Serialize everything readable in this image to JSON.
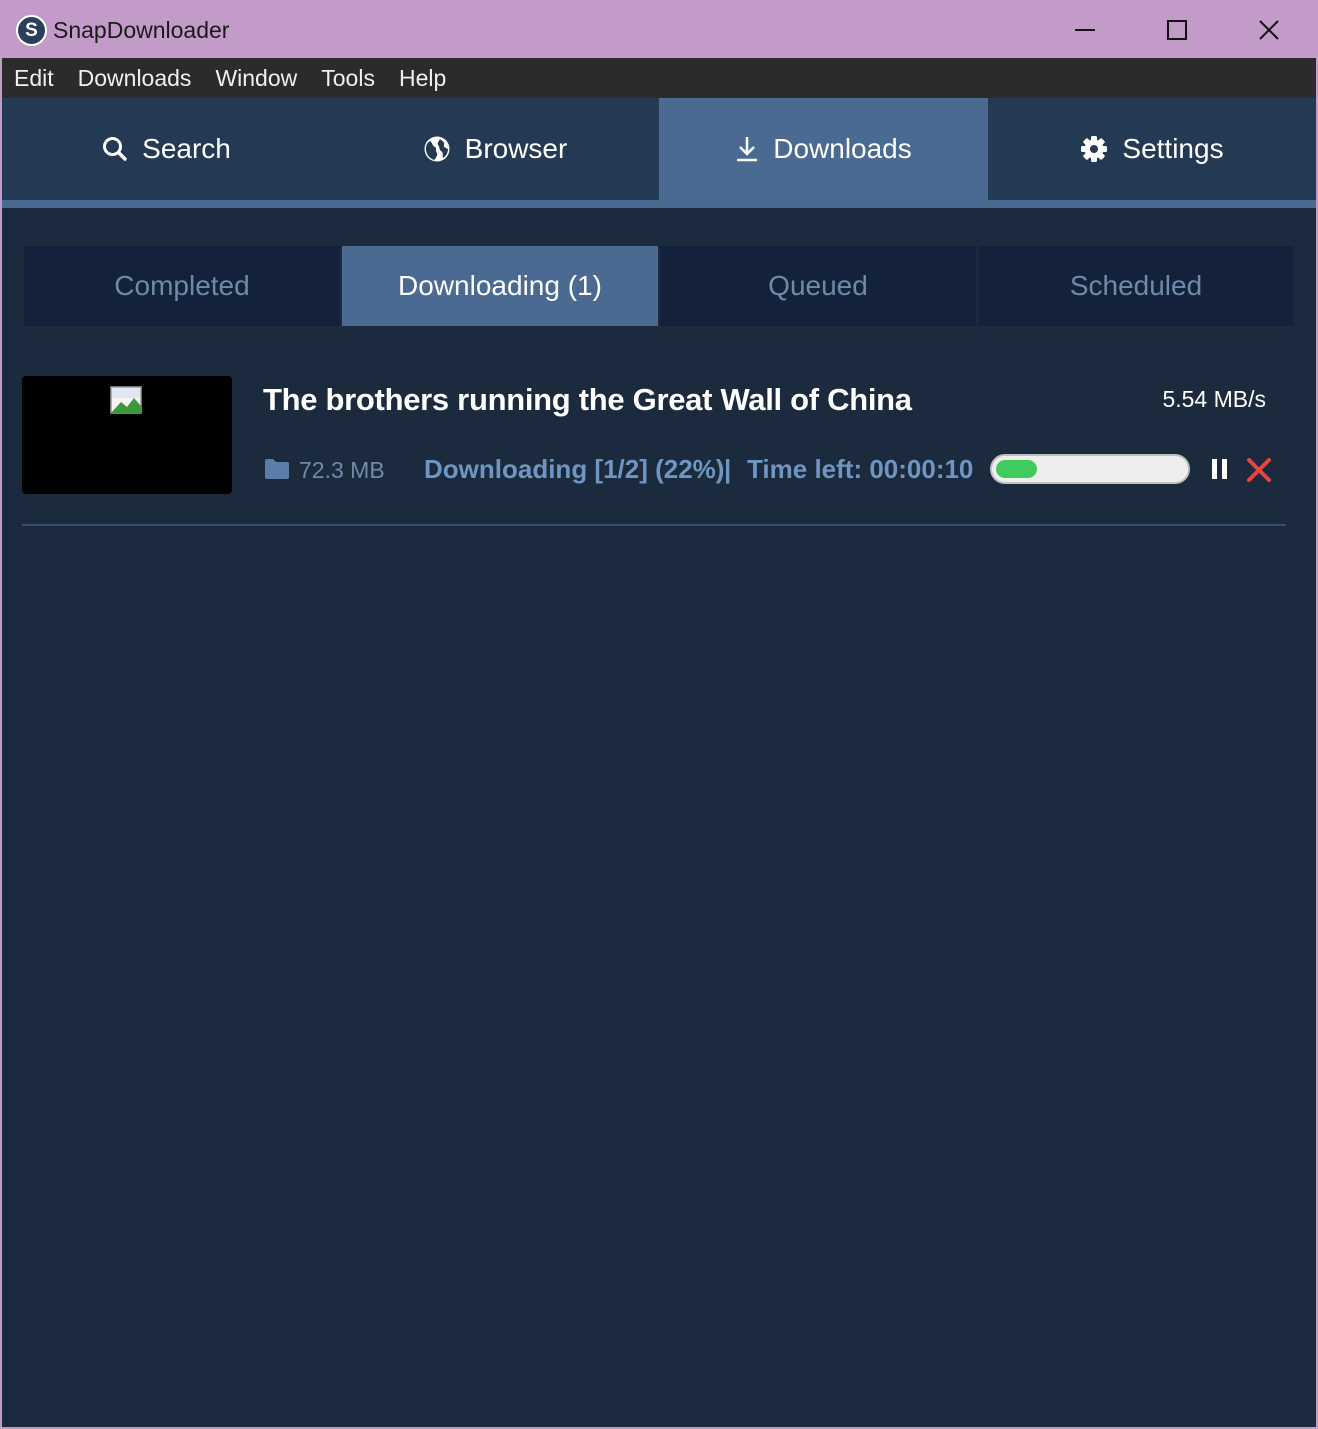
{
  "window": {
    "title": "SnapDownloader",
    "logo_letter": "S"
  },
  "menu": [
    "Edit",
    "Downloads",
    "Window",
    "Tools",
    "Help"
  ],
  "main_nav": {
    "tabs": [
      {
        "label": "Search",
        "icon": "search-icon"
      },
      {
        "label": "Browser",
        "icon": "globe-icon"
      },
      {
        "label": "Downloads",
        "icon": "download-icon",
        "active": true
      },
      {
        "label": "Settings",
        "icon": "gear-icon"
      }
    ]
  },
  "sub_tabs": [
    {
      "label": "Completed"
    },
    {
      "label": "Downloading (1)",
      "active": true
    },
    {
      "label": "Queued"
    },
    {
      "label": "Scheduled"
    }
  ],
  "downloads": [
    {
      "title": "The brothers running the Great Wall of China",
      "speed": "5.54 MB/s",
      "size": "72.3 MB",
      "status": "Downloading [1/2] (22%)",
      "separator": "|",
      "time_left": "Time left: 00:00:10",
      "progress": 0.22
    }
  ],
  "colors": {
    "accent": "#4a6a91",
    "background": "#1b2a3c",
    "progress_fill": "#3fcc5c",
    "cancel": "#e8453c"
  }
}
